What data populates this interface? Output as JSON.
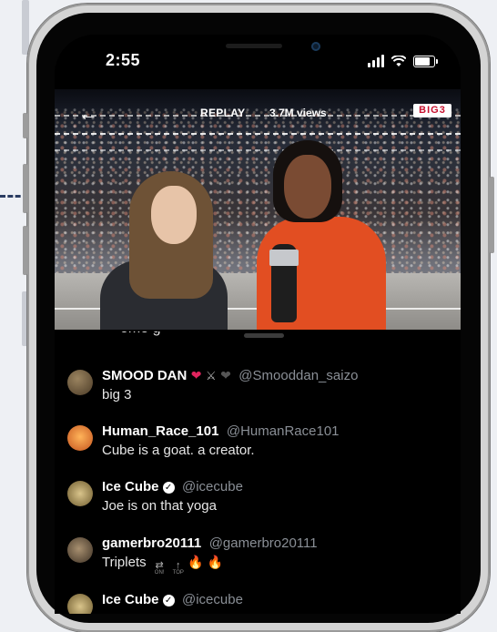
{
  "status": {
    "time": "2:55"
  },
  "video": {
    "replay_label": "REPLAY",
    "views": "3.7M views",
    "logo_text": "BIG3"
  },
  "comments": [
    {
      "name": "SMOOD DAN",
      "name_emoji": [
        "red-heart",
        "swords",
        "black-heart"
      ],
      "handle": "@Smooddan_saizo",
      "text": "big 3",
      "avatar_color": "#6b5a3e"
    },
    {
      "name": "Human_Race_101",
      "handle": "@HumanRace101",
      "text": "Cube is a goat. a creator.",
      "avatar_color": "#d7742b"
    },
    {
      "name": "Ice Cube",
      "verified": true,
      "handle": "@icecube",
      "text": "Joe is on that yoga",
      "avatar_color": "#b8a16a"
    },
    {
      "name": "gamerbro20111",
      "handle": "@gamerbro20111",
      "text": "Triplets",
      "text_emoji": [
        "on-arrows",
        "top-arrow",
        "fire",
        "fire"
      ],
      "emoji_captions": [
        "ON!",
        "TOP"
      ],
      "avatar_color": "#7a6a52"
    },
    {
      "name": "Ice Cube",
      "verified": true,
      "handle": "@icecube",
      "text": "",
      "avatar_color": "#b8a16a"
    }
  ],
  "colors": {
    "orange_jacket": "#e24e22",
    "screen_bg": "#000000",
    "muted_text": "#8a8f96",
    "accent_red": "#e0245e"
  }
}
